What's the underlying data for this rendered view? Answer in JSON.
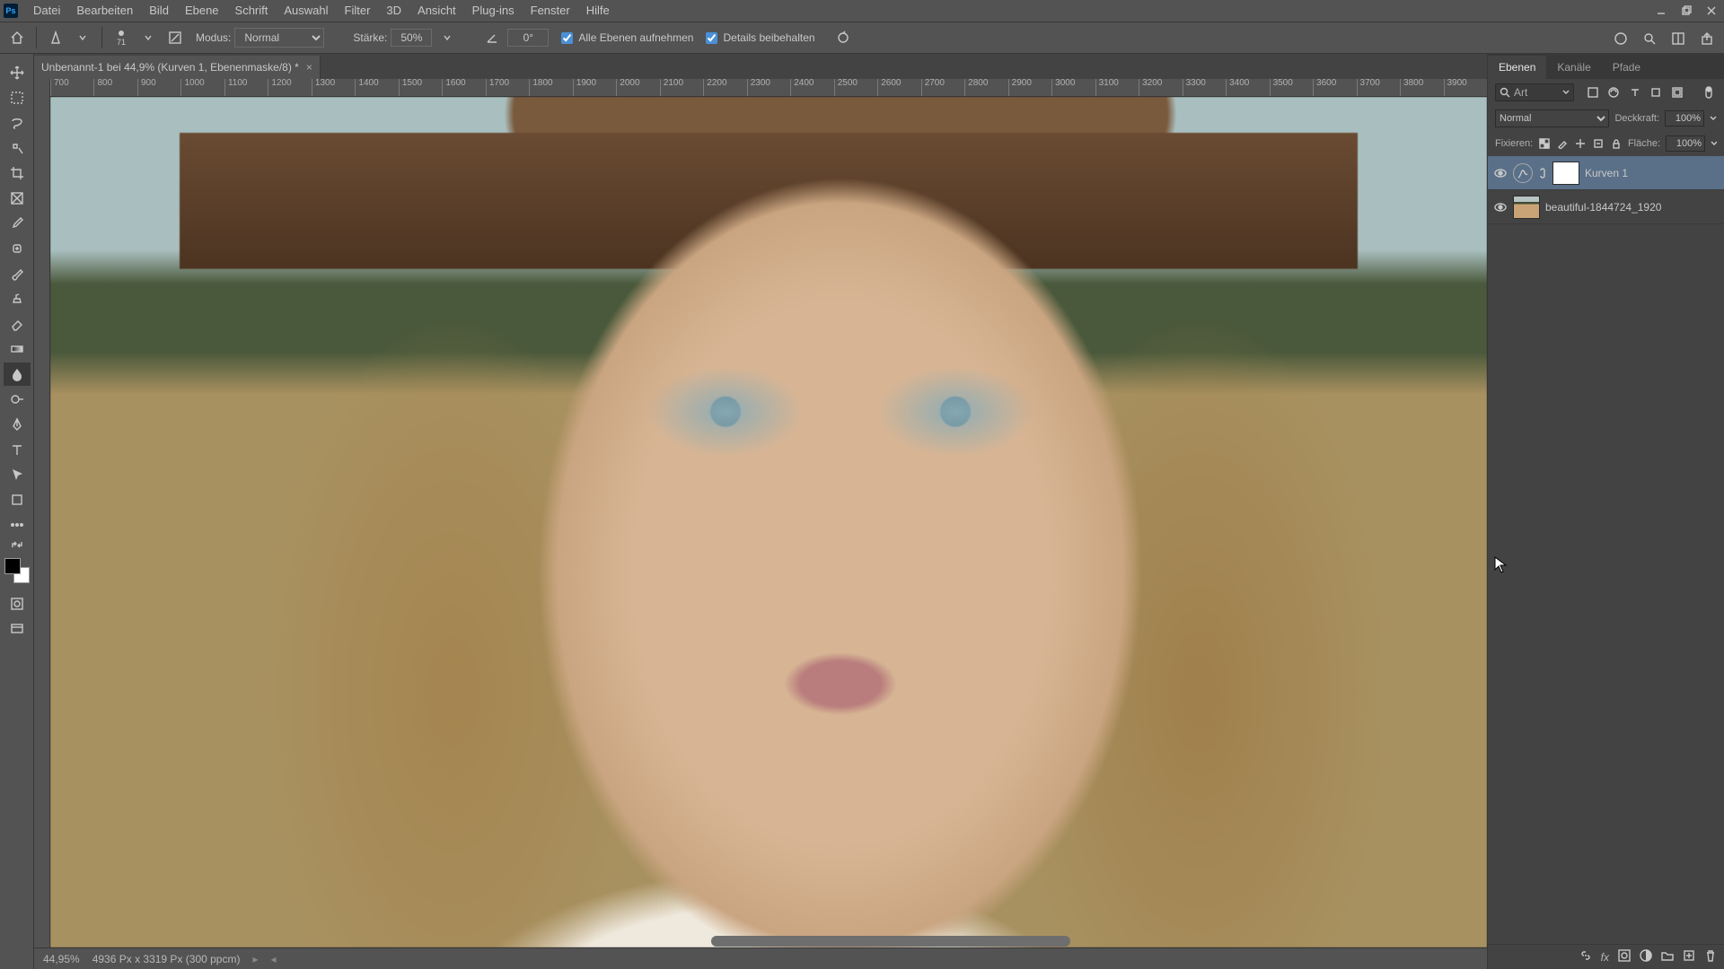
{
  "app": {
    "initials": "Ps"
  },
  "menu": [
    "Datei",
    "Bearbeiten",
    "Bild",
    "Ebene",
    "Schrift",
    "Auswahl",
    "Filter",
    "3D",
    "Ansicht",
    "Plug-ins",
    "Fenster",
    "Hilfe"
  ],
  "options": {
    "modus_label": "Modus:",
    "modus_value": "Normal",
    "staerke_label": "Stärke:",
    "staerke_value": "50%",
    "angle_value": "0°",
    "sample_all": "Alle Ebenen aufnehmen",
    "protect_detail": "Details beibehalten",
    "brush_size": "71"
  },
  "document": {
    "tab_title": "Unbenannt-1 bei 44,9% (Kurven 1, Ebenenmaske/8) *"
  },
  "ruler": {
    "start": 700,
    "end": 4000,
    "step": 100
  },
  "status": {
    "zoom": "44,95%",
    "dims": "4936 Px x 3319 Px (300 ppcm)"
  },
  "panels": {
    "tabs": [
      "Ebenen",
      "Kanäle",
      "Pfade"
    ],
    "search_placeholder": "Art",
    "blend_label": "Normal",
    "opacity_label": "Deckkraft:",
    "opacity_value": "100%",
    "lock_label": "Fixieren:",
    "fill_label": "Fläche:",
    "fill_value": "100%"
  },
  "layers": [
    {
      "name": "Kurven 1",
      "kind": "adjustment",
      "selected": true
    },
    {
      "name": "beautiful-1844724_1920",
      "kind": "image",
      "selected": false
    }
  ]
}
